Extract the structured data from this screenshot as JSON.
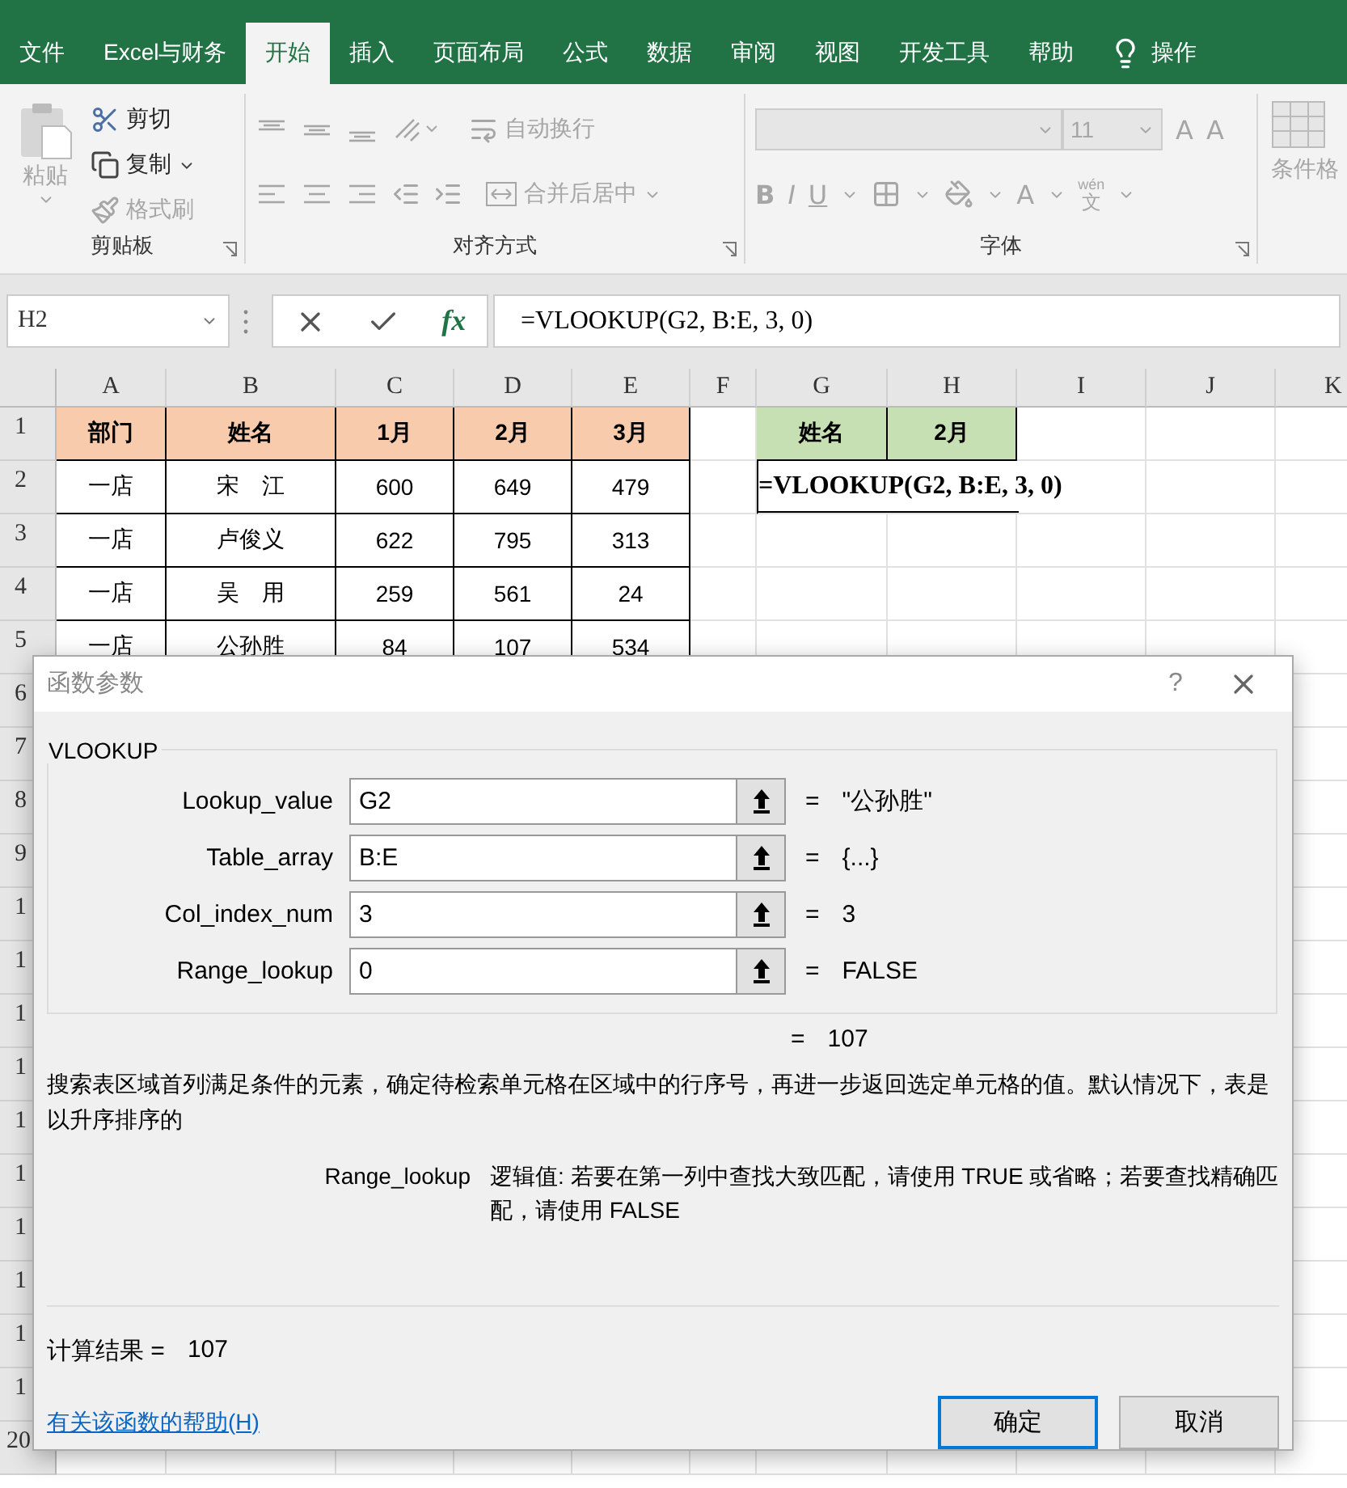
{
  "ribbon_tabs": [
    {
      "label": "文件",
      "selected": false
    },
    {
      "label": "Excel与财务",
      "selected": false
    },
    {
      "label": "开始",
      "selected": true
    },
    {
      "label": "插入",
      "selected": false
    },
    {
      "label": "页面布局",
      "selected": false
    },
    {
      "label": "公式",
      "selected": false
    },
    {
      "label": "数据",
      "selected": false
    },
    {
      "label": "审阅",
      "selected": false
    },
    {
      "label": "视图",
      "selected": false
    },
    {
      "label": "开发工具",
      "selected": false
    },
    {
      "label": "帮助",
      "selected": false
    }
  ],
  "tell_me": "操作",
  "ribbon": {
    "clipboard": {
      "title": "剪贴板",
      "paste": {
        "label": "粘贴",
        "disabled": true
      },
      "items": [
        {
          "kind": "cut",
          "label": "剪切",
          "disabled": false
        },
        {
          "kind": "copy",
          "label": "复制",
          "disabled": false
        },
        {
          "kind": "painter",
          "label": "格式刷",
          "disabled": true
        }
      ]
    },
    "alignment": {
      "title": "对齐方式",
      "disabled": true,
      "wrap_text": "自动换行",
      "merge_center": "合并后居中"
    },
    "font": {
      "title": "字体",
      "disabled": true,
      "font_size": "11",
      "grow": "A",
      "shrink": "A",
      "bold": "B",
      "italic": "I",
      "underline": "U",
      "font_color": "A",
      "phonetic_top": "wén",
      "phonetic_bottom": "文"
    },
    "styles": {
      "conditional_formatting": "条件格"
    }
  },
  "formula_bar": {
    "name_box": "H2",
    "fx": "fx",
    "formula": "=VLOOKUP(G2, B:E, 3, 0)"
  },
  "sheet": {
    "columns": [
      "A",
      "B",
      "C",
      "D",
      "E",
      "F",
      "G",
      "H",
      "I",
      "J",
      "K"
    ],
    "rows": [
      {
        "header": "1",
        "cells": [
          {
            "kind": "title",
            "text": "部门"
          },
          {
            "kind": "title",
            "text": "姓名"
          },
          {
            "kind": "title",
            "text": "1月"
          },
          {
            "kind": "title",
            "text": "2月"
          },
          {
            "kind": "title",
            "text": "3月"
          },
          {
            "kind": "blank"
          },
          {
            "kind": "lookup-title",
            "text": "姓名"
          },
          {
            "kind": "lookup-title",
            "text": "2月"
          }
        ]
      },
      {
        "header": "2",
        "cells": [
          {
            "kind": "data",
            "text": "一店"
          },
          {
            "kind": "data",
            "text": "宋　江"
          },
          {
            "kind": "data",
            "text": "600"
          },
          {
            "kind": "data",
            "text": "649"
          },
          {
            "kind": "data",
            "text": "479"
          },
          {
            "kind": "blank"
          },
          {
            "kind": "formula",
            "text": "=VLOOKUP(G2, B:E, 3, 0)"
          }
        ]
      },
      {
        "header": "3",
        "cells": [
          {
            "kind": "data",
            "text": "一店"
          },
          {
            "kind": "data",
            "text": "卢俊义"
          },
          {
            "kind": "data",
            "text": "622"
          },
          {
            "kind": "data",
            "text": "795"
          },
          {
            "kind": "data",
            "text": "313"
          }
        ]
      },
      {
        "header": "4",
        "cells": [
          {
            "kind": "data",
            "text": "一店"
          },
          {
            "kind": "data",
            "text": "吴　用"
          },
          {
            "kind": "data",
            "text": "259"
          },
          {
            "kind": "data",
            "text": "561"
          },
          {
            "kind": "data",
            "text": "24"
          }
        ]
      },
      {
        "header": "5",
        "cells": [
          {
            "kind": "data",
            "text": "一店"
          },
          {
            "kind": "data",
            "text": "公孙胜"
          },
          {
            "kind": "data",
            "text": "84"
          },
          {
            "kind": "data",
            "text": "107"
          },
          {
            "kind": "data",
            "text": "534"
          }
        ]
      },
      {
        "header": "6",
        "cells": []
      },
      {
        "header": "7",
        "cells": []
      },
      {
        "header": "8",
        "cells": []
      },
      {
        "header": "9",
        "cells": []
      },
      {
        "header": "1",
        "cells": []
      },
      {
        "header": "1",
        "cells": []
      },
      {
        "header": "1",
        "cells": []
      },
      {
        "header": "1",
        "cells": []
      },
      {
        "header": "1",
        "cells": []
      },
      {
        "header": "1",
        "cells": []
      },
      {
        "header": "1",
        "cells": []
      },
      {
        "header": "1",
        "cells": []
      },
      {
        "header": "1",
        "cells": []
      },
      {
        "header": "1",
        "cells": []
      },
      {
        "header": "20",
        "cells": []
      }
    ]
  },
  "dialog": {
    "title": "函数参数",
    "help": "?",
    "function_name": "VLOOKUP",
    "arguments": [
      {
        "name": "Lookup_value",
        "value": "G2",
        "equals": "=",
        "result": "\"公孙胜\""
      },
      {
        "name": "Table_array",
        "value": "B:E",
        "equals": "=",
        "result": "{...}"
      },
      {
        "name": "Col_index_num",
        "value": "3",
        "equals": "=",
        "result": "3"
      },
      {
        "name": "Range_lookup",
        "value": "0",
        "equals": "=",
        "result": "FALSE"
      }
    ],
    "overall": {
      "equals": "=",
      "value": "107"
    },
    "description": "搜索表区域首列满足条件的元素，确定待检索单元格在区域中的行序号，再进一步返回选定单元格的值。默认情况下，表是以升序排序的",
    "argument_help": {
      "name": "Range_lookup",
      "text": "逻辑值: 若要在第一列中查找大致匹配，请使用 TRUE 或省略；若要查找精确匹配，请使用 FALSE"
    },
    "result": {
      "label": "计算结果 =",
      "value": "107"
    },
    "help_link": "有关该函数的帮助(H)",
    "buttons": [
      {
        "label": "确定",
        "default": true
      },
      {
        "label": "取消",
        "default": false
      }
    ]
  }
}
